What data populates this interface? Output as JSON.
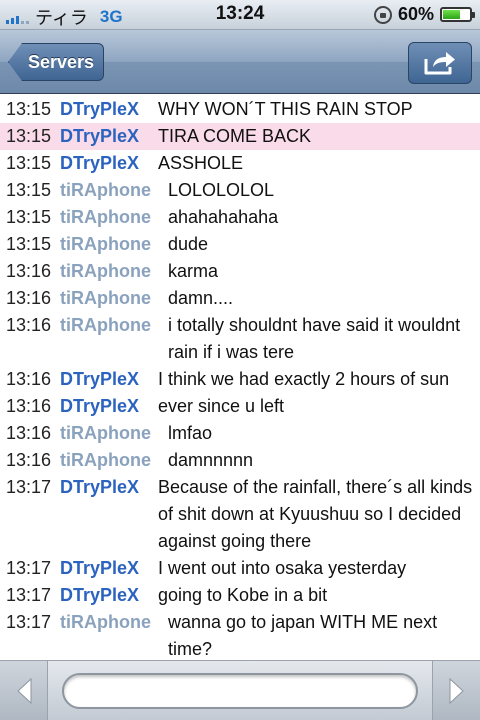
{
  "colors": {
    "nick_dtryplex": "#2b63bf",
    "nick_tiraphone": "#8aa2bd",
    "highlight_row": "#fadbe9",
    "signal_blue": "#1f73c9"
  },
  "status_bar": {
    "carrier": "ティラ",
    "network": "3G",
    "time": "13:24",
    "battery": "60%",
    "battery_level": 0.6
  },
  "nav": {
    "back_label": "Servers",
    "share_icon": "share-icon"
  },
  "messages": [
    {
      "time": "13:15",
      "nick": "DTryPleX",
      "text": "WHY WON´T THIS RAIN STOP",
      "highlight": false
    },
    {
      "time": "13:15",
      "nick": "DTryPleX",
      "text": "TIRA COME BACK",
      "highlight": true
    },
    {
      "time": "13:15",
      "nick": "DTryPleX",
      "text": "ASSHOLE",
      "highlight": false
    },
    {
      "time": "13:15",
      "nick": "tiRAphone",
      "text": "LOLOLOLOL",
      "highlight": false
    },
    {
      "time": "13:15",
      "nick": "tiRAphone",
      "text": "ahahahahaha",
      "highlight": false
    },
    {
      "time": "13:15",
      "nick": "tiRAphone",
      "text": "dude",
      "highlight": false
    },
    {
      "time": "13:16",
      "nick": "tiRAphone",
      "text": "karma",
      "highlight": false
    },
    {
      "time": "13:16",
      "nick": "tiRAphone",
      "text": "damn....",
      "highlight": false
    },
    {
      "time": "13:16",
      "nick": "tiRAphone",
      "text": "i totally shouldnt have said it wouldnt rain if i was tere",
      "highlight": false
    },
    {
      "time": "13:16",
      "nick": "DTryPleX",
      "text": "I think we had exactly 2 hours of sun",
      "highlight": false
    },
    {
      "time": "13:16",
      "nick": "DTryPleX",
      "text": "ever since u left",
      "highlight": false
    },
    {
      "time": "13:16",
      "nick": "tiRAphone",
      "text": "lmfao",
      "highlight": false
    },
    {
      "time": "13:16",
      "nick": "tiRAphone",
      "text": "damnnnnn",
      "highlight": false
    },
    {
      "time": "13:17",
      "nick": "DTryPleX",
      "text": "Because of the rainfall, there´s all kinds of shit down at Kyuushuu so I decided against going there",
      "highlight": false
    },
    {
      "time": "13:17",
      "nick": "DTryPleX",
      "text": "I went out into osaka yesterday",
      "highlight": false
    },
    {
      "time": "13:17",
      "nick": "DTryPleX",
      "text": "going to Kobe in a bit",
      "highlight": false
    },
    {
      "time": "13:17",
      "nick": "tiRAphone",
      "text": "wanna go to japan WITH ME next time?",
      "highlight": false
    }
  ],
  "toolbar": {
    "prev_icon": "left-arrow-icon",
    "next_icon": "right-arrow-icon",
    "input_value": "",
    "input_placeholder": ""
  }
}
